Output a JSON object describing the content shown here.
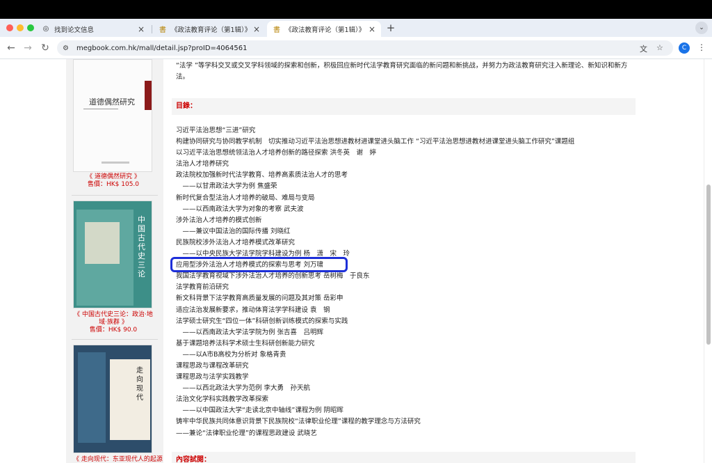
{
  "browser": {
    "tabs": [
      {
        "label": "找到论文信息",
        "icon": "globe-icon"
      },
      {
        "label": "《政法教育评论（第1辑）》 - ​",
        "icon": "book-site-icon"
      },
      {
        "label": "《政法教育评论（第1辑）》 - ​",
        "icon": "book-site-icon"
      }
    ],
    "new_tab": "+",
    "url": "megbook.com.hk/mall/detail.jsp?proID=4064561",
    "profile_initial": "C"
  },
  "sidebar": {
    "books": [
      {
        "cover_title": "道德偶然研究",
        "title": "《 道德偶然研究 》",
        "price": "售價：HK$ 105.0"
      },
      {
        "cover_title": "中国古代史三论",
        "cover_subtitle": "政治 地域 族群",
        "title": "《 中国古代史三论：政治·地域·族群 》",
        "price": "售價：HK$ 90.0"
      },
      {
        "cover_title": "走向现代",
        "title": "《 走向现代：东亚现代人的起源",
        "price": ""
      }
    ]
  },
  "content": {
    "intro_text": "“法学 ”等学科交叉或交叉学科领域的探索和创新，积极回应新时代法学教育研究面临的新问题和新挑战，并努力为政法教育研究注入新理论、新知识和新方法。",
    "toc_heading": "目錄：",
    "toc_items": [
      "习近平法治思想“三进”研究",
      "构建协同研究与协同教学机制　切实推动习近平法治思想进教材进课堂进头脑工作 “习近平法治思想进教材进课堂进头脑工作研究”课题组",
      "以习近平法治思想统领法治人才培养创新的路径探索 洪冬英　谢　婷",
      "法治人才培养研究",
      "政法院校加强新时代法学教育、培养高素质法治人才的思考",
      "　——以甘肃政法大学为例 焦盛荣",
      "新时代复合型法治人才培养的破局、难局与变局",
      "　——以西南政法大学为对象的考察 武夫波",
      "涉外法治人才培养的模式创新",
      "　——兼议中国法治的国际传播 刘晓红",
      "民族院校涉外法治人才培养模式改革研究",
      "　——以中央民族大学法学院学科建设为例 杨　潇　宋　玲",
      "应用型涉外法治人才培养模式的探索与思考 刘万啸",
      "我国法学教育视域下涉外法治人才培养的创新思考 岳树梅　于良东",
      "法学教育前沿研究",
      "新文科背景下法学教育高质量发展的问题及其对策 岳彩申",
      "适应法治发展新要求，推动体育法学学科建设 袁　钢",
      "法学硕士研究生“四位一体”科研创新训练模式的探索与实践",
      "　——以西南政法大学法学院为例 张吉喜　吕明辉",
      "基于课题培养法科学术硕士生科研创新能力研究",
      "　——以A市B高校为分析对 象格青贵",
      "课程思政与课程改革研究",
      "课程思政与法学实践教学",
      "　——以西北政法大学为范例 李大勇　孙天航",
      "法治文化学科实践教学改革探索",
      "　——以中国政法大学“走读北京中轴线”课程为例 阴昭晖",
      "铸牢中华民族共同体意识背景下民族院校“法律职业伦理”课程的教学理念与方法研究",
      "——兼论“法律职业伦理”的课程思政建设 武晓艺"
    ],
    "next_heading": "內容試閱："
  },
  "colors": {
    "accent_red": "#cc0000",
    "highlight_blue": "#1d2fd8"
  }
}
